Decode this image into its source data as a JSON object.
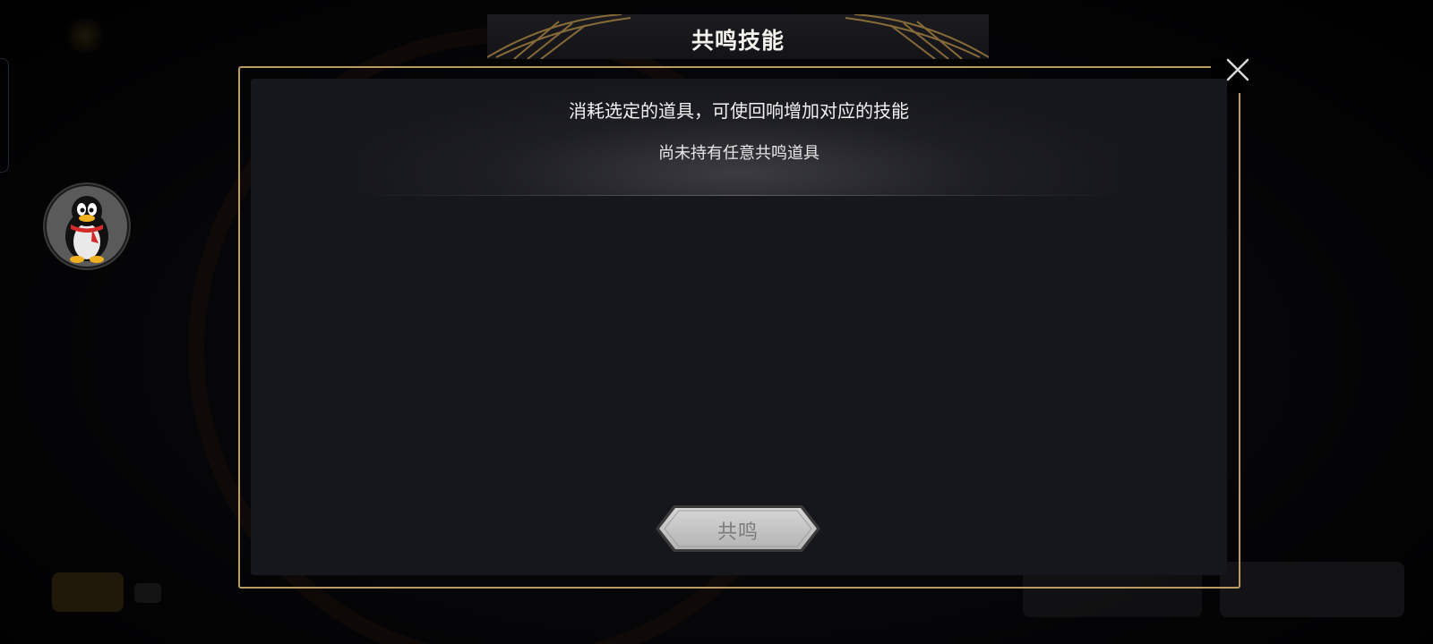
{
  "dialog": {
    "title": "共鸣技能",
    "description": "消耗选定的道具，可使回响增加对应的技能",
    "empty_message": "尚未持有任意共鸣道具",
    "resonate_button_label": "共鸣",
    "resonate_button_enabled": false
  },
  "icons": {
    "close": "close-x-icon",
    "avatar": "penguin-avatar-icon"
  },
  "colors": {
    "frame_gold": "#b99b63",
    "panel_bg": "#16171c",
    "button_disabled_text": "#7c7c7c"
  }
}
